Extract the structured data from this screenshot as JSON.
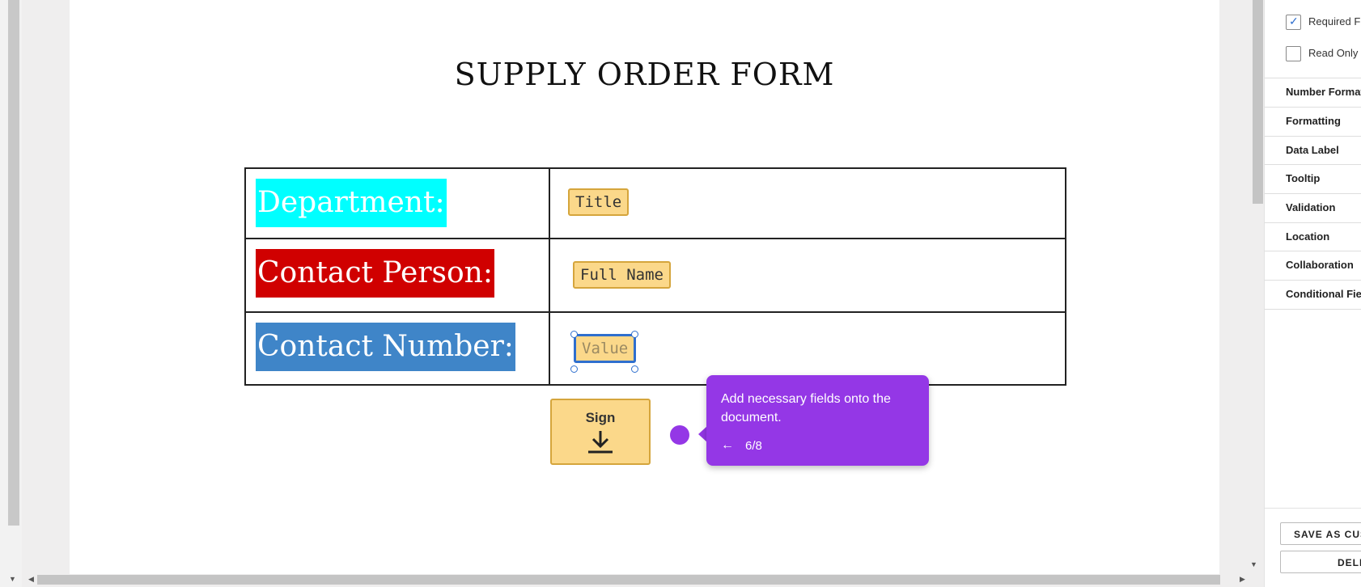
{
  "document": {
    "title": "SUPPLY ORDER FORM",
    "rows": [
      {
        "label": "Department:",
        "label_color": "#00ffff",
        "field": "Title"
      },
      {
        "label": "Contact Person:",
        "label_color": "#d00000",
        "field": "Full Name"
      },
      {
        "label": "Contact Number:",
        "label_color": "#3f85c8",
        "field": "Value"
      }
    ],
    "sign_label": "Sign"
  },
  "tooltip": {
    "text": "Add necessary fields onto the document.",
    "back_icon": "←",
    "step": "6/8",
    "color": "#9437e6"
  },
  "panel": {
    "checkboxes": [
      {
        "label": "Required Field",
        "checked": true
      },
      {
        "label": "Read Only",
        "checked": false
      }
    ],
    "sections": [
      "Number Format",
      "Formatting",
      "Data Label",
      "Tooltip",
      "Validation",
      "Location",
      "Collaboration",
      "Conditional Fields"
    ],
    "buttons": {
      "save": "SAVE AS CUSTOM FIELD",
      "delete": "DELETE"
    }
  }
}
